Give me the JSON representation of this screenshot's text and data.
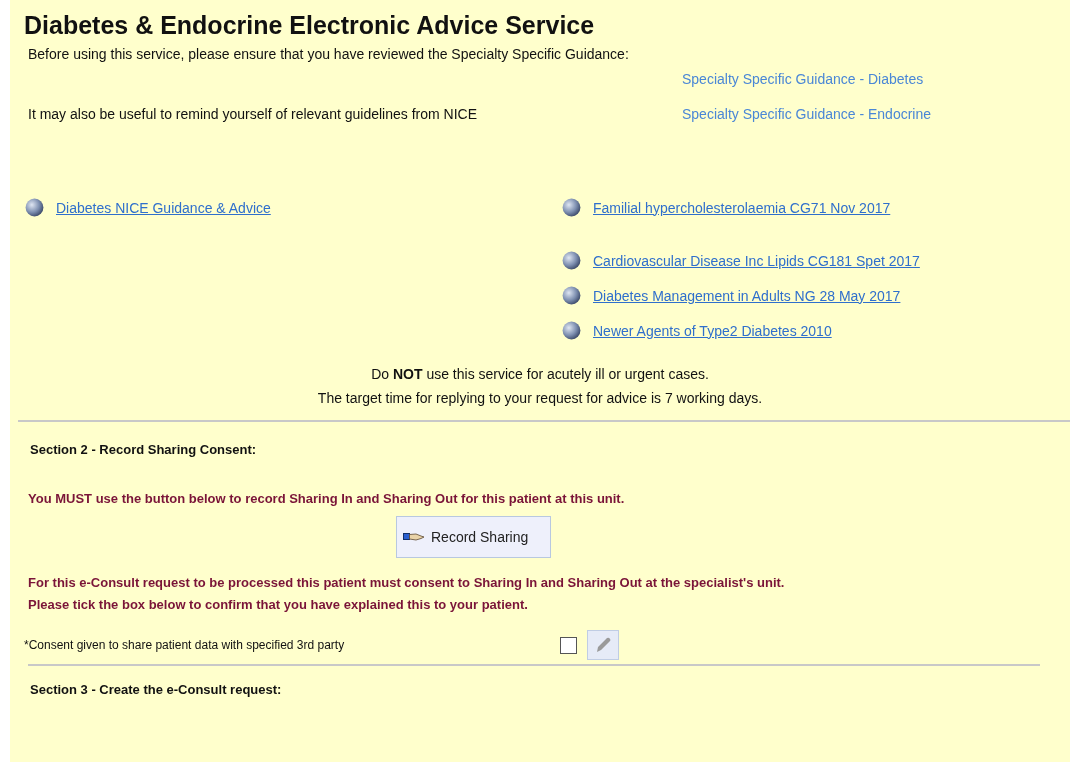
{
  "title": "Diabetes & Endocrine Electronic Advice Service",
  "intro": "Before using this service, please ensure that you have reviewed the Specialty Specific Guidance:",
  "reminder": "It may also be useful to remind yourself of relevant guidelines from NICE",
  "guidance_links": [
    "Specialty Specific Guidance - Diabetes",
    "Specialty Specific Guidance - Endocrine"
  ],
  "nice_links_left": [
    "Diabetes NICE Guidance & Advice"
  ],
  "nice_links_right": [
    "Familial hypercholesterolaemia CG71 Nov 2017",
    "Cardiovascular Disease Inc Lipids CG181 Spet 2017",
    "Diabetes Management in Adults NG 28 May 2017",
    "Newer Agents of Type2 Diabetes 2010"
  ],
  "notice": [
    "Do **NOT** use this service for acutely ill or urgent cases.",
    "The target time for replying to your request for advice is 7 working days."
  ],
  "section2": {
    "heading": "Section 2 - Record Sharing Consent:",
    "warning": "You MUST use the button below to record Sharing In and Sharing Out for this patient at this unit.",
    "button": "Record Sharing",
    "explanation": [
      "For this e-Consult request to be processed this patient must consent to Sharing In and Sharing Out at the specialist's unit.",
      "Please tick the box below to confirm that you have explained this to your patient."
    ],
    "consent": {
      "label": "*Consent given to share patient data with specified 3rd party",
      "checked": false
    }
  },
  "section3": {
    "heading": "Section 3 - Create the e-Consult request:"
  }
}
